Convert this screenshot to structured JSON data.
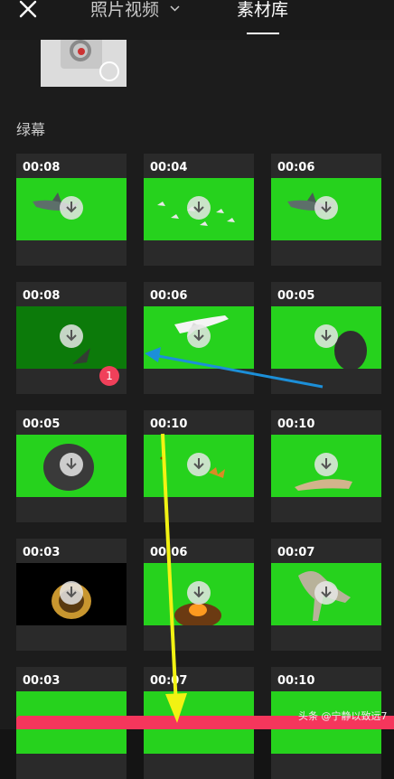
{
  "header": {
    "photos_tab": "照片视频",
    "material_tab": "素材库"
  },
  "section_title": "绿幕",
  "badge": "1",
  "watermark": "头条 @宁静以致远7",
  "clips": [
    {
      "duration": "00:08",
      "subject": "shark"
    },
    {
      "duration": "00:04",
      "subject": "birds"
    },
    {
      "duration": "00:06",
      "subject": "shark"
    },
    {
      "duration": "00:08",
      "subject": "fish-tail"
    },
    {
      "duration": "00:06",
      "subject": "airplane"
    },
    {
      "duration": "00:05",
      "subject": "rock"
    },
    {
      "duration": "00:05",
      "subject": "meteor"
    },
    {
      "duration": "00:10",
      "subject": "butterfly"
    },
    {
      "duration": "00:10",
      "subject": "tiger"
    },
    {
      "duration": "00:03",
      "subject": "mgm-logo"
    },
    {
      "duration": "00:06",
      "subject": "explosion"
    },
    {
      "duration": "00:07",
      "subject": "dinosaur"
    },
    {
      "duration": "00:03",
      "subject": "green"
    },
    {
      "duration": "00:07",
      "subject": "green"
    },
    {
      "duration": "00:10",
      "subject": "green"
    }
  ],
  "colors": {
    "green_screen": "#26d21d",
    "dark_green": "#0c7a0a",
    "accent": "#f5365c",
    "blue_arrow": "#1c8fd8",
    "yellow_arrow": "#f2f213"
  }
}
